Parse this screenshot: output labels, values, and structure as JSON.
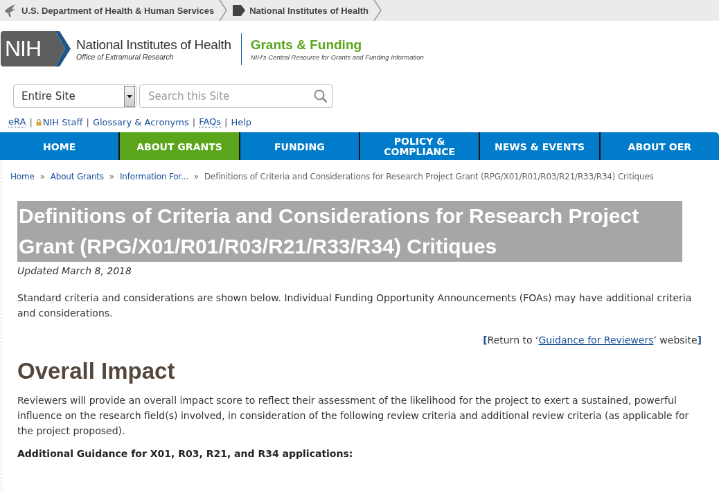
{
  "top_bar": {
    "items": [
      {
        "label": "U.S. Department of Health & Human Services",
        "kind": "hhs"
      },
      {
        "label": "National Institutes of Health",
        "kind": "nih"
      }
    ]
  },
  "header": {
    "logo_mark": "NIH",
    "logo_title": "National Institutes of Health",
    "logo_subtitle": "Office of Extramural Research",
    "site_title": "Grants & Funding",
    "site_tagline": "NIH’s Central Resource for Grants and Funding Information"
  },
  "search": {
    "scope": "Entire Site",
    "placeholder": "Search this Site"
  },
  "utility_links": {
    "separator": "|",
    "items": [
      {
        "label": "eRA",
        "kind": "abbr"
      },
      {
        "label": "NIH Staff",
        "kind": "locked"
      },
      {
        "label": "Glossary & Acronyms",
        "kind": "plain"
      },
      {
        "label": "FAQs",
        "kind": "abbr"
      },
      {
        "label": "Help",
        "kind": "plain"
      }
    ]
  },
  "nav": [
    {
      "label": "HOME",
      "selected": false
    },
    {
      "label": "ABOUT GRANTS",
      "selected": true
    },
    {
      "label": "FUNDING",
      "selected": false
    },
    {
      "label": "POLICY & COMPLIANCE",
      "selected": false
    },
    {
      "label": "NEWS & EVENTS",
      "selected": false
    },
    {
      "label": "ABOUT OER",
      "selected": false
    }
  ],
  "breadcrumb": {
    "separator": "»",
    "links": [
      "Home",
      "About Grants",
      "Information For..."
    ],
    "current": "Definitions of Criteria and Considerations for Research Project Grant (RPG/X01/R01/R03/R21/R33/R34) Critiques"
  },
  "page": {
    "title": "Definitions of Criteria and Considerations for Research Project Grant (RPG/X01/R01/R03/R21/R33/R34) Critiques",
    "title_selected": true,
    "updated": "Updated March 8, 2018",
    "intro": "Standard criteria and considerations are shown below. Individual Funding Opportunity Announcements (FOAs) may have additional criteria and considerations.",
    "return_prefix": "**[**Return to ‘",
    "return_link": "Guidance for Reviewers",
    "return_suffix": "’ website**]**"
  },
  "section": {
    "heading": "Overall Impact",
    "body": "Reviewers will provide an overall impact score to reflect their assessment of the likelihood for the project to exert a sustained, powerful influence on the research field(s) involved, in consideration of the following review criteria and additional review criteria (as applicable for the project proposed).",
    "subheading": "Additional Guidance for X01, R03, R21, and R34 applications:"
  }
}
